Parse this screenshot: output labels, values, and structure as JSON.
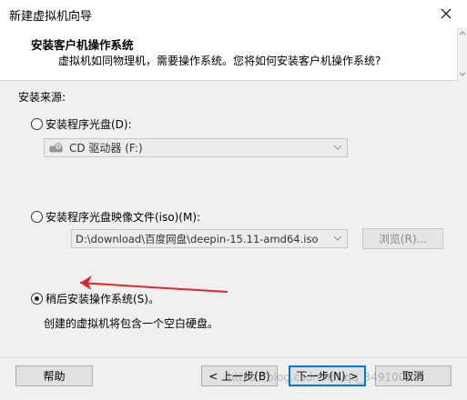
{
  "window": {
    "title": "新建虚拟机向导"
  },
  "header": {
    "title": "安装客户机操作系统",
    "subtitle": "虚拟机如同物理机，需要操作系统。您将如何安装客户机操作系统?"
  },
  "source": {
    "label": "安装来源:",
    "disc": {
      "label": "安装程序光盘(D):",
      "selected": false,
      "drive": "CD 驱动器 (F:)",
      "drive_icon": "cd-drive-icon"
    },
    "iso": {
      "label": "安装程序光盘映像文件(iso)(M):",
      "selected": false,
      "path": "D:\\download\\百度网盘\\deepin-15.11-amd64.iso",
      "browse_label": "浏览(R)..."
    },
    "later": {
      "label": "稍后安装操作系统(S)。",
      "selected": true,
      "note": "创建的虚拟机将包含一个空白硬盘。"
    }
  },
  "footer": {
    "help": "帮助",
    "back": "< 上一步(B)",
    "next": "下一步(N) >",
    "cancel": "取消",
    "watermark": "https://blog.csdn.net/qq_34910048"
  },
  "colors": {
    "annotation_arrow": "#e0262b",
    "focus_border": "#0078d7"
  }
}
